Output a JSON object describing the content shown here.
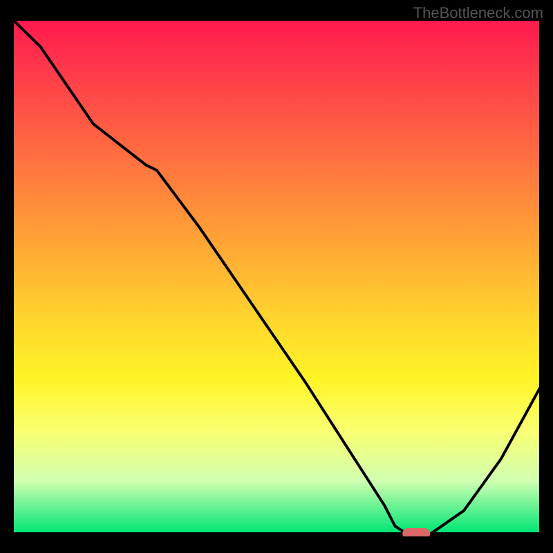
{
  "watermark": "TheBottleneck.com",
  "chart_data": {
    "type": "line",
    "title": "",
    "xlabel": "",
    "ylabel": "",
    "xlim": [
      0,
      100
    ],
    "ylim": [
      0,
      100
    ],
    "series": [
      {
        "name": "bottleneck-curve",
        "x": [
          0,
          5,
          15,
          25,
          27,
          35,
          45,
          55,
          65,
          70,
          72,
          75,
          78,
          85,
          92,
          100
        ],
        "y": [
          100,
          95,
          80,
          72,
          71,
          60,
          45,
          30,
          14,
          6,
          2,
          0,
          0,
          5,
          15,
          30
        ]
      }
    ],
    "marker": {
      "x": 76,
      "y": 0,
      "color": "#dc6868"
    },
    "gradient": {
      "top": "#ff1a4f",
      "mid": "#ffda2c",
      "bottom": "#00e676"
    }
  }
}
